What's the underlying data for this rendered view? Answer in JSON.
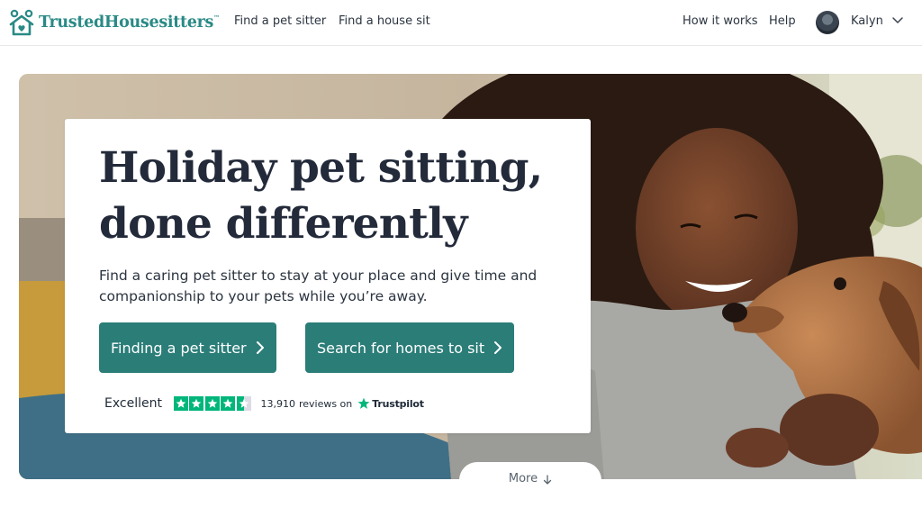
{
  "header": {
    "brand": "TrustedHousesitters",
    "brand_mark": "™",
    "nav_left": [
      "Find a pet sitter",
      "Find a house sit"
    ],
    "nav_right": [
      "How it works",
      "Help"
    ],
    "user_name": "Kalyn"
  },
  "hero": {
    "headline_line1": "Holiday pet sitting,",
    "headline_line2": "done differently",
    "subtext": "Find a caring pet sitter to stay at your place and give time and companionship to your pets while you’re away.",
    "primary_button": "Finding a pet sitter",
    "secondary_button": "Search for homes to sit",
    "rating": {
      "label": "Excellent",
      "stars": 4.5,
      "review_count": "13,910",
      "reviews_on": "reviews on",
      "provider": "Trustpilot"
    },
    "more_label": "More"
  },
  "colors": {
    "brand_teal": "#2a8a86",
    "button_teal": "#2b7d78",
    "trustpilot_green": "#00b67a",
    "headline_ink": "#232a3a"
  },
  "icons": [
    "house-paw-logo-icon",
    "chevron-down-icon",
    "chevron-right-icon",
    "star-icon",
    "arrow-down-icon"
  ]
}
